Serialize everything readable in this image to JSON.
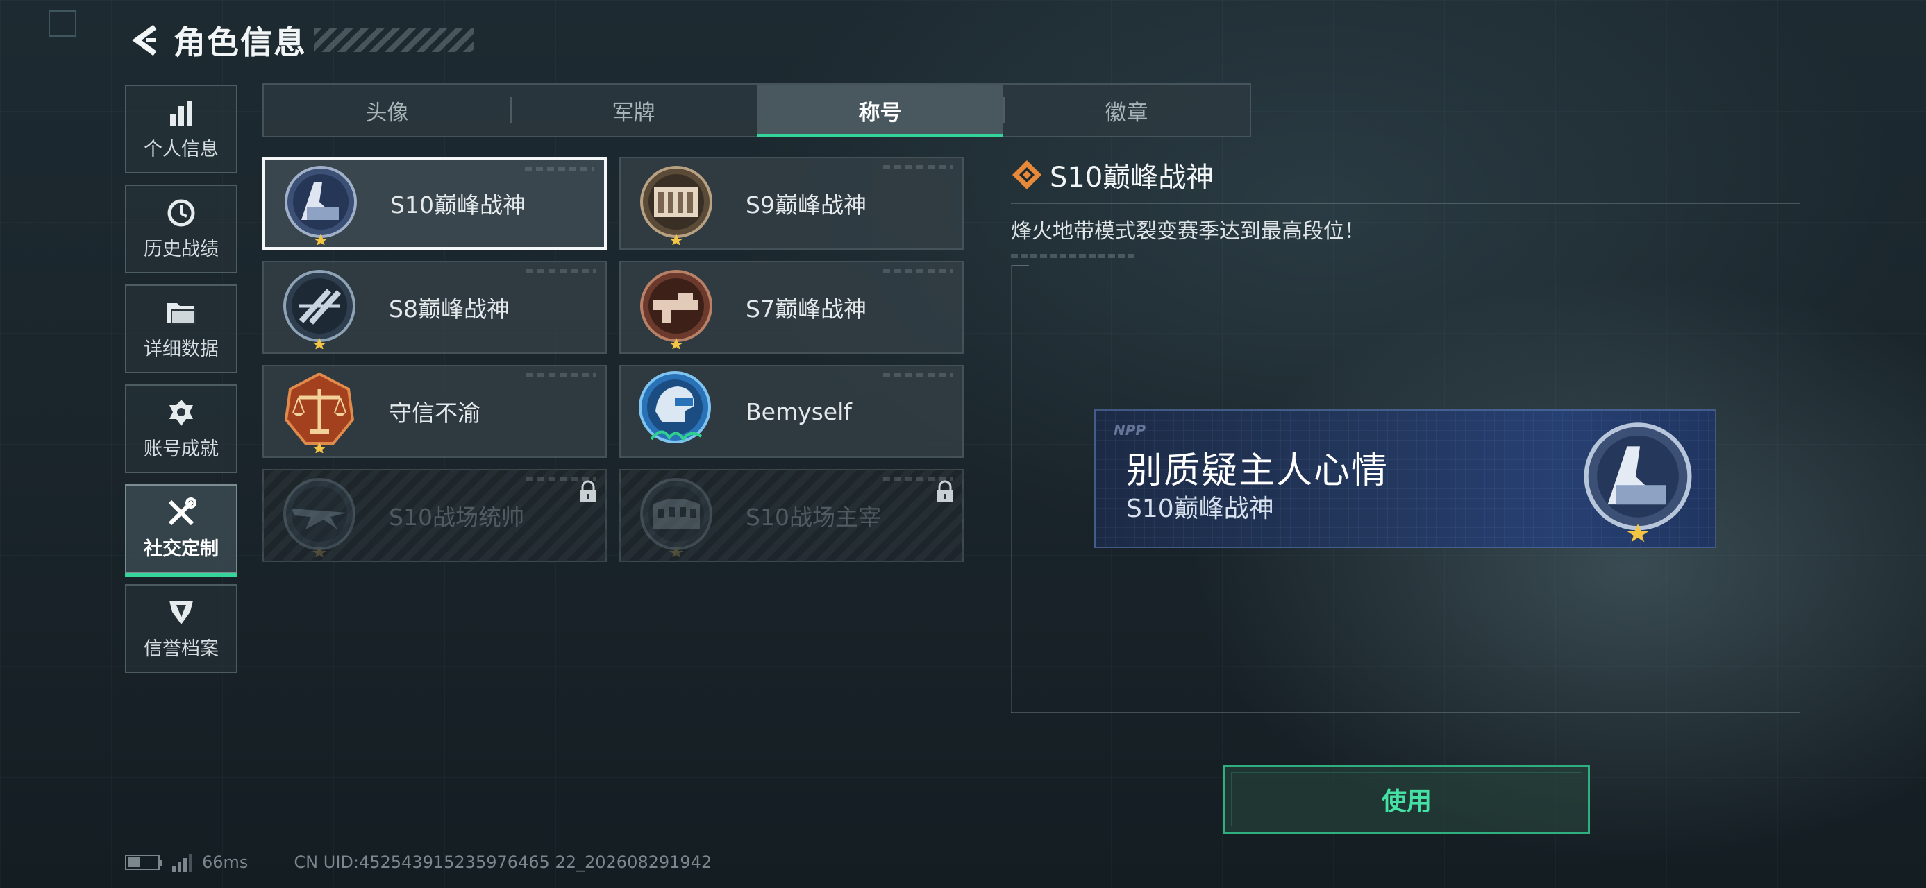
{
  "header": {
    "title": "角色信息",
    "back_icon": "back-arrow-icon"
  },
  "sidebar": {
    "items": [
      {
        "label": "个人信息",
        "icon": "bar-chart-icon",
        "active": false
      },
      {
        "label": "历史战绩",
        "icon": "clock-icon",
        "active": false
      },
      {
        "label": "详细数据",
        "icon": "folder-icon",
        "active": false
      },
      {
        "label": "账号成就",
        "icon": "achievement-icon",
        "active": false
      },
      {
        "label": "社交定制",
        "icon": "tools-icon",
        "active": true
      },
      {
        "label": "信誉档案",
        "icon": "reputation-icon",
        "active": false
      }
    ]
  },
  "tabs": [
    {
      "label": "头像",
      "active": false
    },
    {
      "label": "军牌",
      "active": false
    },
    {
      "label": "称号",
      "active": true
    },
    {
      "label": "徽章",
      "active": false
    }
  ],
  "titles": [
    {
      "name": "S10巅峰战神",
      "badge": "s10-peak-badge-icon",
      "selected": true,
      "locked": false
    },
    {
      "name": "S9巅峰战神",
      "badge": "s9-peak-badge-icon",
      "selected": false,
      "locked": false
    },
    {
      "name": "S8巅峰战神",
      "badge": "s8-peak-badge-icon",
      "selected": false,
      "locked": false
    },
    {
      "name": "S7巅峰战神",
      "badge": "s7-peak-badge-icon",
      "selected": false,
      "locked": false
    },
    {
      "name": "守信不渝",
      "badge": "scales-badge-icon",
      "selected": false,
      "locked": false
    },
    {
      "name": "Bemyself",
      "badge": "helmet-signature-badge-icon",
      "selected": false,
      "locked": false
    },
    {
      "name": "S10战场统帅",
      "badge": "aircraft-badge-icon",
      "selected": false,
      "locked": true
    },
    {
      "name": "S10战场主宰",
      "badge": "colosseum-badge-icon",
      "selected": false,
      "locked": true
    }
  ],
  "detail": {
    "name": "S10巅峰战神",
    "description": "烽火地带模式裂变赛季达到最高段位！",
    "icon": "diamond-icon"
  },
  "banner": {
    "logo": "NPP",
    "main_text": "别质疑主人心情",
    "sub_text": "S10巅峰战神"
  },
  "use_button": {
    "label": "使用"
  },
  "status_bar": {
    "ping": "66ms",
    "uid": "CN UID:452543915235976465 22_202608291942"
  },
  "colors": {
    "accent": "#35d49a",
    "button_text": "#45e0a4",
    "banner_bg": "#23375d"
  }
}
